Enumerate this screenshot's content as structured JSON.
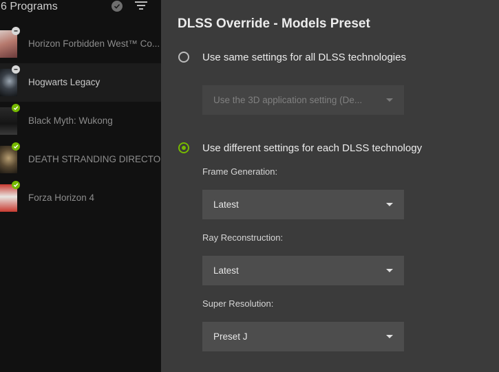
{
  "programs": {
    "count_label": "6 Programs",
    "check_all_icon": "check-circle-icon",
    "filter_icon": "filter-icon",
    "items": [
      {
        "name": "Horizon Forbidden West™ Co...",
        "status": "removed",
        "selected": false
      },
      {
        "name": "Hogwarts Legacy",
        "status": "removed",
        "selected": true
      },
      {
        "name": "Black Myth: Wukong",
        "status": "ok",
        "selected": false
      },
      {
        "name": "DEATH STRANDING DIRECTOR'S CUT",
        "status": "ok",
        "selected": false
      },
      {
        "name": "Forza Horizon 4",
        "status": "ok",
        "selected": false
      }
    ]
  },
  "panel": {
    "title": "DLSS Override - Models Preset",
    "option_same": {
      "label": "Use same settings for all DLSS technologies",
      "checked": false,
      "dropdown_value": "Use the 3D application setting (De..."
    },
    "option_different": {
      "label": "Use different settings for each DLSS technology",
      "checked": true
    },
    "fields": [
      {
        "label": "Frame Generation:",
        "value": "Latest"
      },
      {
        "label": "Ray Reconstruction:",
        "value": "Latest"
      },
      {
        "label": "Super Resolution:",
        "value": "Preset J"
      }
    ]
  },
  "colors": {
    "accent": "#76b900",
    "panel_bg": "#3b3b3b",
    "list_bg": "#111111",
    "dropdown_bg": "#4d4d4d"
  }
}
